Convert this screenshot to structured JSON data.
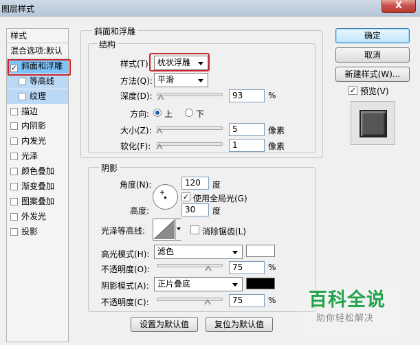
{
  "window": {
    "title": "图层样式",
    "close_label": "X"
  },
  "sidebar": {
    "items": [
      {
        "label": "样式",
        "checkbox": false,
        "checked": false,
        "state": "header"
      },
      {
        "label": "混合选项:默认",
        "checkbox": false,
        "checked": false,
        "state": "header"
      },
      {
        "label": "斜面和浮雕",
        "checkbox": true,
        "checked": true,
        "state": "selected"
      },
      {
        "label": "等高线",
        "checkbox": true,
        "checked": false,
        "state": "sub"
      },
      {
        "label": "纹理",
        "checkbox": true,
        "checked": false,
        "state": "sub"
      },
      {
        "label": "描边",
        "checkbox": true,
        "checked": false,
        "state": "normal"
      },
      {
        "label": "内阴影",
        "checkbox": true,
        "checked": false,
        "state": "normal"
      },
      {
        "label": "内发光",
        "checkbox": true,
        "checked": false,
        "state": "normal"
      },
      {
        "label": "光泽",
        "checkbox": true,
        "checked": false,
        "state": "normal"
      },
      {
        "label": "颜色叠加",
        "checkbox": true,
        "checked": false,
        "state": "normal"
      },
      {
        "label": "渐变叠加",
        "checkbox": true,
        "checked": false,
        "state": "normal"
      },
      {
        "label": "图案叠加",
        "checkbox": true,
        "checked": false,
        "state": "normal"
      },
      {
        "label": "外发光",
        "checkbox": true,
        "checked": false,
        "state": "normal"
      },
      {
        "label": "投影",
        "checkbox": true,
        "checked": false,
        "state": "normal"
      }
    ]
  },
  "bevel": {
    "group_title": "斜面和浮雕",
    "structure_title": "结构",
    "style_label": "样式(T):",
    "style_value": "枕状浮雕",
    "technique_label": "方法(Q):",
    "technique_value": "平滑",
    "depth_label": "深度(D):",
    "depth_value": "93",
    "depth_unit": "%",
    "depth_slider": 0.093,
    "direction_label": "方向:",
    "direction_up": "上",
    "direction_down": "下",
    "direction_selected": "上",
    "size_label": "大小(Z):",
    "size_value": "5",
    "size_unit": "像素",
    "size_slider": 0.02,
    "soften_label": "软化(F):",
    "soften_value": "1",
    "soften_unit": "像素",
    "soften_slider": 0.01
  },
  "shading": {
    "title": "阴影",
    "angle_label": "角度(N):",
    "angle_value": "120",
    "angle_unit": "度",
    "global_light_label": "使用全局光(G)",
    "global_light_checked": true,
    "altitude_label": "高度:",
    "altitude_value": "30",
    "altitude_unit": "度",
    "gloss_label": "光泽等高线:",
    "antialias_label": "消除锯齿(L)",
    "antialias_checked": false,
    "highlight_mode_label": "高光模式(H):",
    "highlight_mode_value": "滤色",
    "highlight_color": "#ffffff",
    "highlight_opacity_label": "不透明度(O):",
    "highlight_opacity_value": "75",
    "highlight_opacity_unit": "%",
    "highlight_opacity_slider": 0.75,
    "shadow_mode_label": "阴影模式(A):",
    "shadow_mode_value": "正片叠底",
    "shadow_color": "#000000",
    "shadow_opacity_label": "不透明度(C):",
    "shadow_opacity_value": "75",
    "shadow_opacity_unit": "%",
    "shadow_opacity_slider": 0.75
  },
  "footer": {
    "set_default": "设置为默认值",
    "reset_default": "复位为默认值"
  },
  "right": {
    "ok": "确定",
    "cancel": "取消",
    "new_style": "新建样式(W)...",
    "preview_label": "预览(V)",
    "preview_checked": true
  },
  "watermark": {
    "line1": "百科全说",
    "line2": "助你轻松解决"
  }
}
